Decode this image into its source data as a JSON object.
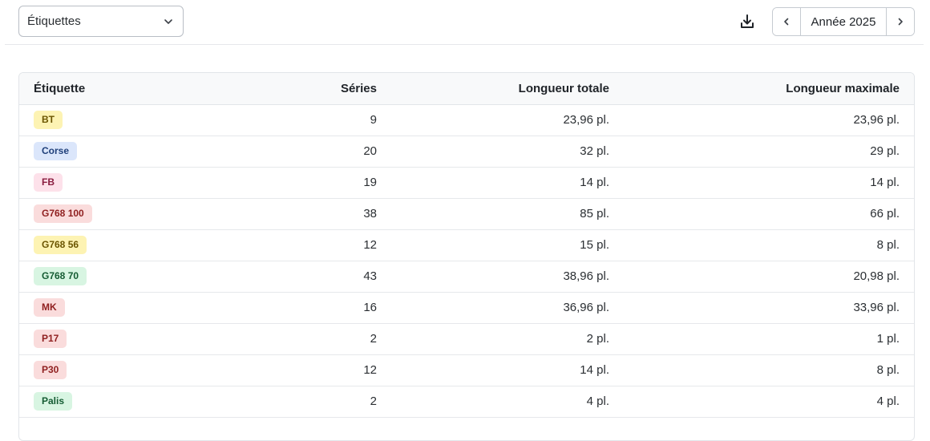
{
  "toolbar": {
    "filter_select": {
      "value": "Étiquettes"
    },
    "year_nav": {
      "label": "Année 2025"
    }
  },
  "table": {
    "columns": [
      "Étiquette",
      "Séries",
      "Longueur totale",
      "Longueur maximale"
    ],
    "rows": [
      {
        "tag": "BT",
        "tag_color": "yellow",
        "series": "9",
        "total": "23,96 pl.",
        "max": "23,96 pl."
      },
      {
        "tag": "Corse",
        "tag_color": "blue",
        "series": "20",
        "total": "32 pl.",
        "max": "29 pl."
      },
      {
        "tag": "FB",
        "tag_color": "pink",
        "series": "19",
        "total": "14 pl.",
        "max": "14 pl."
      },
      {
        "tag": "G768 100",
        "tag_color": "red",
        "series": "38",
        "total": "85 pl.",
        "max": "66 pl."
      },
      {
        "tag": "G768 56",
        "tag_color": "yellow",
        "series": "12",
        "total": "15 pl.",
        "max": "8 pl."
      },
      {
        "tag": "G768 70",
        "tag_color": "green",
        "series": "43",
        "total": "38,96 pl.",
        "max": "20,98 pl."
      },
      {
        "tag": "MK",
        "tag_color": "red",
        "series": "16",
        "total": "36,96 pl.",
        "max": "33,96 pl."
      },
      {
        "tag": "P17",
        "tag_color": "red",
        "series": "2",
        "total": "2 pl.",
        "max": "1 pl."
      },
      {
        "tag": "P30",
        "tag_color": "red",
        "series": "12",
        "total": "14 pl.",
        "max": "8 pl."
      },
      {
        "tag": "Palis",
        "tag_color": "green",
        "series": "2",
        "total": "4 pl.",
        "max": "4 pl."
      }
    ]
  },
  "icons": {
    "select_chevron": "chevron-down-icon",
    "download": "download-icon",
    "prev": "chevron-left-icon",
    "next": "chevron-right-icon"
  }
}
